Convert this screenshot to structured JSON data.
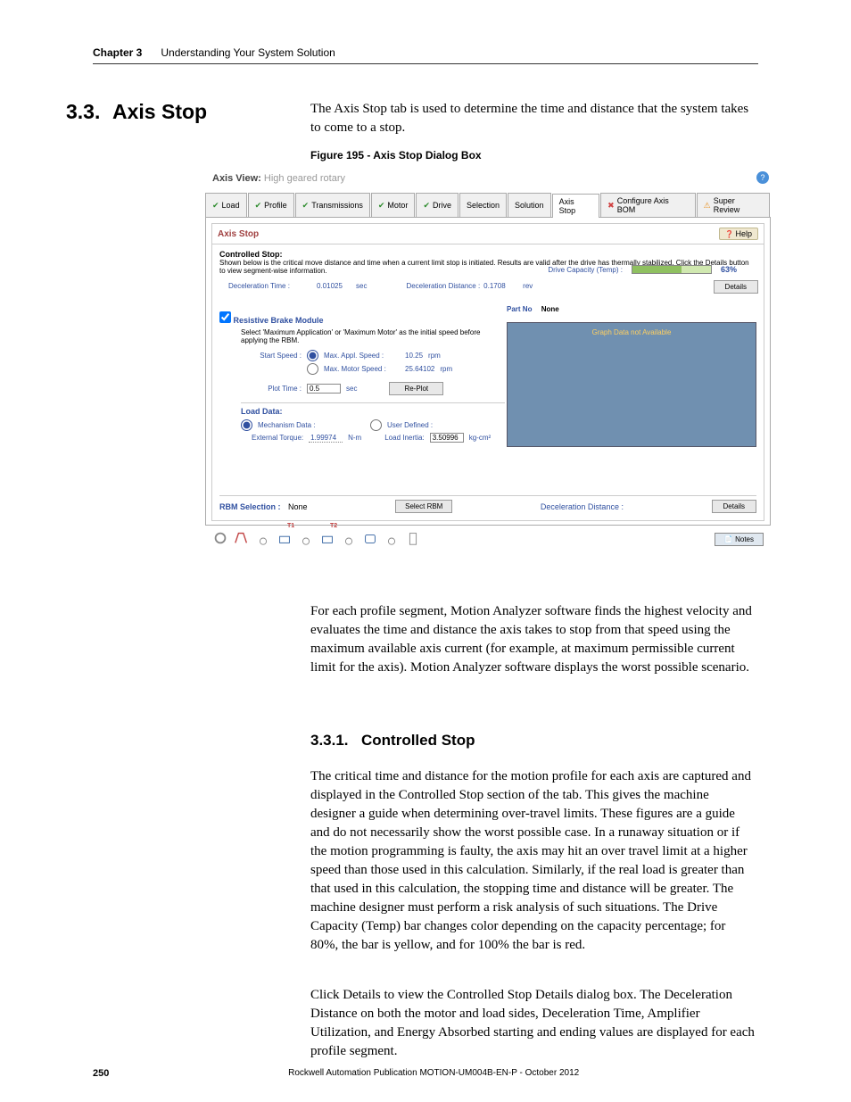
{
  "header": {
    "chapter": "Chapter 3",
    "title": "Understanding Your System Solution"
  },
  "section": {
    "num": "3.3.",
    "title": "Axis Stop"
  },
  "intro": "The Axis Stop tab is used to determine the time and distance that the system takes to come to a stop.",
  "figure_caption": "Figure 195 - Axis Stop Dialog Box",
  "dialog": {
    "axis_view_label": "Axis View:",
    "axis_view_value": "High geared rotary",
    "tabs": [
      "Load",
      "Profile",
      "Transmissions",
      "Motor",
      "Drive",
      "Selection",
      "Solution",
      "Axis Stop",
      "Configure Axis BOM",
      "Super Review"
    ],
    "panel_title": "Axis Stop",
    "help_btn": "Help",
    "ctrl_stop_label": "Controlled Stop:",
    "ctrl_stop_desc": "Shown below is the critical move distance and time when a current limit stop is initiated. Results are valid after the drive has thermally stabilized. Click the Details button to view segment-wise information.",
    "decel_time_label": "Deceleration Time :",
    "decel_time_value": "0.01025",
    "decel_time_unit": "sec",
    "decel_dist_label": "Deceleration Distance :",
    "decel_dist_value": "0.1708",
    "decel_dist_unit": "rev",
    "drive_cap_label": "Drive Capacity (Temp) :",
    "drive_cap_pct": "63%",
    "details": "Details",
    "rbm_check": "Resistive Brake Module",
    "rbm_desc": "Select 'Maximum Application' or 'Maximum Motor' as the initial speed before applying the RBM.",
    "start_speed_label": "Start Speed :",
    "max_appl_label": "Max. Appl. Speed :",
    "max_appl_value": "10.25",
    "max_appl_unit": "rpm",
    "max_motor_label": "Max. Motor Speed :",
    "max_motor_value": "25.64102",
    "max_motor_unit": "rpm",
    "plot_time_label": "Plot Time :",
    "plot_time_value": "0.5",
    "plot_time_unit": "sec",
    "replot": "Re-Plot",
    "load_data_title": "Load Data:",
    "mech_data_label": "Mechanism Data :",
    "user_def_label": "User Defined :",
    "ext_torque_label": "External Torque:",
    "ext_torque_value": "1.99974",
    "ext_torque_unit": "N-m",
    "load_inertia_label": "Load Inertia:",
    "load_inertia_value": "3.50996",
    "load_inertia_unit": "kg-cm²",
    "part_no_label": "Part No",
    "part_no_value": "None",
    "graph_msg": "Graph Data not Available",
    "rbm_sel_label": "RBM Selection :",
    "rbm_sel_value": "None",
    "select_rbm": "Select RBM",
    "decel_dist_bottom": "Deceleration Distance :",
    "t1": "T1",
    "t2": "T2",
    "notes": "Notes"
  },
  "p1": "For each profile segment, Motion Analyzer software finds the highest velocity and evaluates the time and distance the axis takes to stop from that speed using the maximum available axis current (for example, at maximum permissible current limit for the axis). Motion Analyzer software displays the worst possible scenario.",
  "subsec": {
    "num": "3.3.1.",
    "title": "Controlled Stop"
  },
  "p2": "The critical time and distance for the motion profile for each axis are captured and displayed in the Controlled Stop section of the tab. This gives the machine designer a guide when determining over-travel limits. These figures are a guide and do not necessarily show the worst possible case. In a runaway situation or if the motion programming is faulty, the axis may hit an over travel limit at a higher speed than those used in this calculation. Similarly, if the real load is greater than that used in this calculation, the stopping time and distance will be greater. The machine designer must perform a risk analysis of such situations. The Drive Capacity (Temp) bar changes color depending on the capacity percentage; for 80%, the bar is yellow, and for 100% the bar is red.",
  "p3": "Click Details to view the Controlled Stop Details dialog box. The Deceleration Distance on both the motor and load sides, Deceleration Time, Amplifier Utilization, and Energy Absorbed starting and ending values are displayed for each profile segment.",
  "footer": {
    "page": "250",
    "pub": "Rockwell Automation Publication MOTION-UM004B-EN-P - October 2012"
  }
}
